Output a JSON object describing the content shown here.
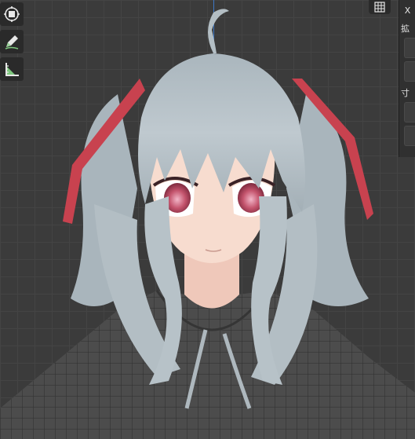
{
  "toolbar": {
    "tools": [
      {
        "name": "transform-tool",
        "icon": "move-gizmo-icon"
      },
      {
        "name": "annotate-tool",
        "icon": "pen-icon"
      },
      {
        "name": "measure-tool",
        "icon": "ruler-angle-icon"
      }
    ],
    "grid_toggle_icon": "grid-icon"
  },
  "side_panel": {
    "close_label": "X",
    "scale_label": "拡",
    "size_label": "寸"
  },
  "colors": {
    "viewport_bg": "#3b3b3b",
    "grid_line": "#444444",
    "axis_z": "#3f7fd6",
    "hair": "#b9c4cb",
    "ribbon": "#c8424f",
    "skin": "#f7dccf",
    "eyes": "#b8455e",
    "hoodie": "#4a4a4a",
    "tool_accent": "#7ec87e"
  }
}
